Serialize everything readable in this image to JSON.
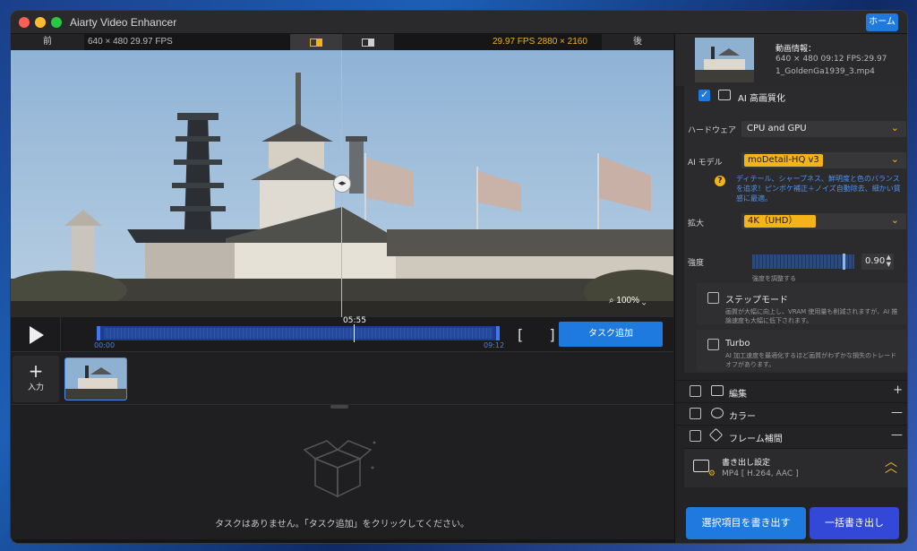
{
  "window": {
    "title": "Aiarty Video Enhancer",
    "home_label": "ホーム"
  },
  "infobar": {
    "before_label": "前",
    "source_info": "640 × 480  29.97 FPS",
    "output_info": "29.97 FPS   2880 × 2160",
    "after_label": "後"
  },
  "preview": {
    "zoom": "100%"
  },
  "timeline": {
    "current_time": "05:55",
    "start_time": "00:00",
    "end_time": "09:12",
    "add_task_label": "タスク追加",
    "brackets": "[ ]"
  },
  "clips": {
    "input_label": "入力"
  },
  "tasks": {
    "empty_message": "タスクはありません。「タスク追加」をクリックしてください。"
  },
  "video_info": {
    "title": "動画情報：",
    "line1": "640 × 480  09:12  FPS:29.97",
    "line2": "1_GoldenGa1939_3.mp4"
  },
  "ai_section": {
    "title": "AI 高画質化",
    "checked": true,
    "hardware_label": "ハードウェア",
    "hardware_value": "CPU and GPU",
    "model_label": "AI モデル",
    "model_value": "moDetail-HQ  v3",
    "model_desc": "ディテール、シャープネス、鮮明度と色のバランスを追求！ピンボケ補正＋ノイズ自動除去、細かい質感に最適。",
    "scale_label": "拡大",
    "scale_value": "4K（UHD）",
    "strength_label": "強度",
    "strength_value": "0.90",
    "strength_hint": "強度を調整する",
    "step_mode_label": "ステップモード",
    "step_mode_desc": "画質が大幅に向上し、VRAM 使用量も削減されますが、AI 推論速度も大幅に低下されます。",
    "turbo_label": "Turbo",
    "turbo_desc": "AI 加工速度を最適化するほど画質がわずかな損失のトレードオフがあります。"
  },
  "features": [
    {
      "label": "編集",
      "action": "+"
    },
    {
      "label": "カラー",
      "action": "—"
    },
    {
      "label": "フレーム補間",
      "action": "—"
    }
  ],
  "export": {
    "title": "書き出し設定",
    "format": "MP4 [ H.264, AAC ]",
    "export_selected_label": "選択項目を書き出す",
    "export_all_label": "一括書き出し"
  },
  "colors": {
    "accent": "#1f7ae0",
    "highlight": "#f3b319",
    "batch": "#3348d6"
  }
}
